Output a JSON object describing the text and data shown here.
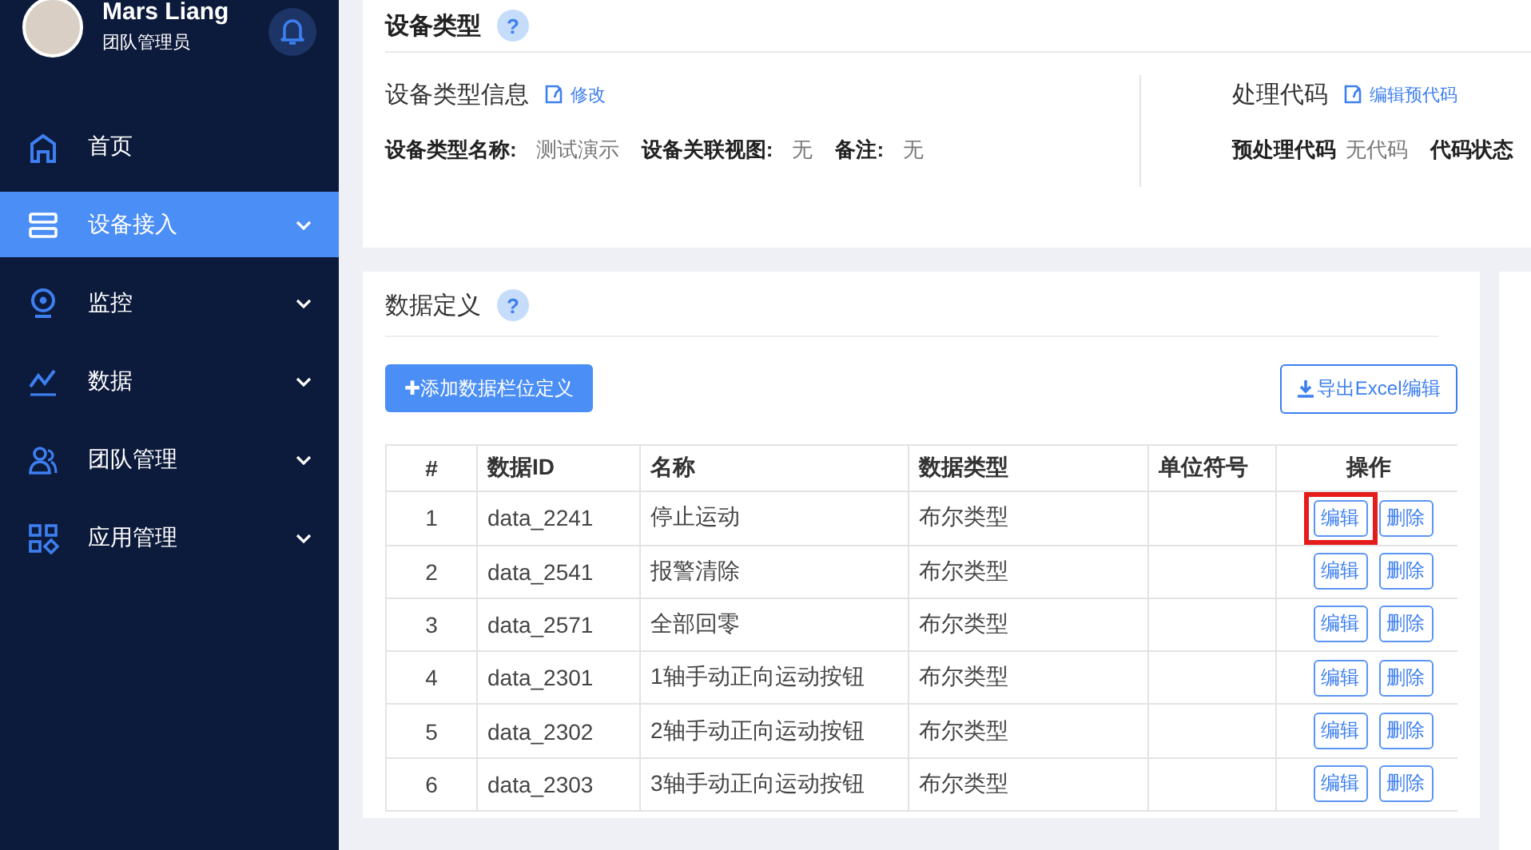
{
  "user": {
    "name": "Mars Liang",
    "role": "团队管理员"
  },
  "nav": [
    {
      "label": "首页",
      "kind": "home",
      "has_children": false,
      "selected": false
    },
    {
      "label": "设备接入",
      "kind": "server",
      "has_children": true,
      "selected": true
    },
    {
      "label": "监控",
      "kind": "camera",
      "has_children": true,
      "selected": false
    },
    {
      "label": "数据",
      "kind": "chart",
      "has_children": true,
      "selected": false
    },
    {
      "label": "团队管理",
      "kind": "people",
      "has_children": true,
      "selected": false
    },
    {
      "label": "应用管理",
      "kind": "apps",
      "has_children": true,
      "selected": false
    }
  ],
  "device_type": {
    "title": "设备类型",
    "help": "?",
    "info": {
      "heading": "设备类型信息",
      "link": "修改",
      "fields": [
        {
          "label": "设备类型名称:",
          "value": "测试演示"
        },
        {
          "label": "设备关联视图:",
          "value": "无"
        },
        {
          "label": "备注:",
          "value": "无"
        }
      ]
    },
    "code": {
      "heading": "处理代码",
      "link": "编辑预代码",
      "fields": [
        {
          "label": "预处理代码",
          "value": "无代码"
        },
        {
          "label": "代码状态"
        }
      ]
    }
  },
  "data_definition": {
    "title": "数据定义",
    "help": "?",
    "add_button": "✚添加数据栏位定义",
    "export_button": "导出Excel编辑",
    "table": {
      "columns": [
        "#",
        "数据ID",
        "名称",
        "数据类型",
        "单位符号",
        "操作"
      ],
      "rows": [
        {
          "index": "1",
          "id": "data_2241",
          "name": "停止运动",
          "type": "布尔类型",
          "edit": "编辑",
          "delete": "删除",
          "highlighted": true
        },
        {
          "index": "2",
          "id": "data_2541",
          "name": "报警清除",
          "type": "布尔类型",
          "edit": "编辑",
          "delete": "删除",
          "highlighted": false
        },
        {
          "index": "3",
          "id": "data_2571",
          "name": "全部回零",
          "type": "布尔类型",
          "edit": "编辑",
          "delete": "删除",
          "highlighted": false
        },
        {
          "index": "4",
          "id": "data_2301",
          "name": "1轴手动正向运动按钮",
          "type": "布尔类型",
          "edit": "编辑",
          "delete": "删除",
          "highlighted": false
        },
        {
          "index": "5",
          "id": "data_2302",
          "name": "2轴手动正向运动按钮",
          "type": "布尔类型",
          "edit": "编辑",
          "delete": "删除",
          "highlighted": false
        },
        {
          "index": "6",
          "id": "data_2303",
          "name": "3轴手动正向运动按钮",
          "type": "布尔类型",
          "edit": "编辑",
          "delete": "删除",
          "highlighted": false
        }
      ]
    }
  }
}
